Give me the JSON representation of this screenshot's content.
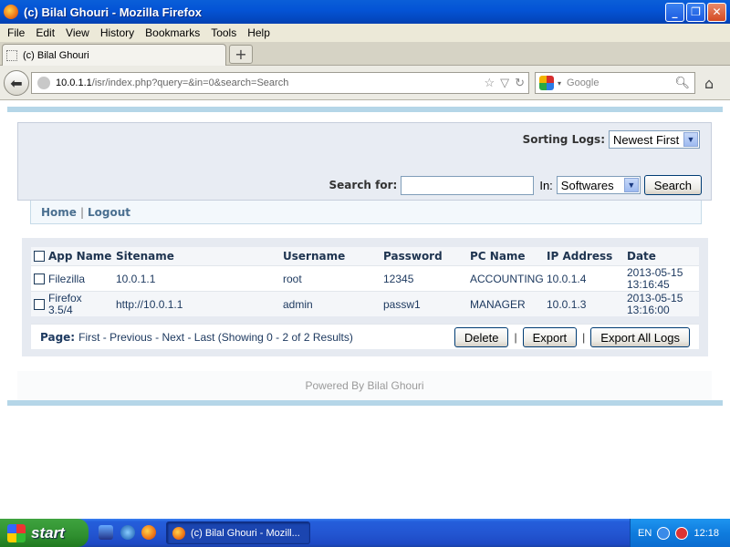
{
  "window": {
    "title": "(c) Bilal Ghouri - Mozilla Firefox"
  },
  "menu": {
    "items": [
      "File",
      "Edit",
      "View",
      "History",
      "Bookmarks",
      "Tools",
      "Help"
    ]
  },
  "tab": {
    "label": "(c) Bilal Ghouri",
    "new_tab_symbol": "+"
  },
  "address": {
    "host": "10.0.1.1",
    "path": "/isr/index.php?query=&in=0&search=Search"
  },
  "search_engine": {
    "placeholder": "Google"
  },
  "page": {
    "sorting_label": "Sorting Logs:",
    "sorting_value": "Newest First",
    "search_label": "Search for:",
    "search_value": "",
    "in_label": "In:",
    "in_value": "Softwares",
    "search_button": "Search",
    "nav": {
      "home": "Home",
      "separator": "|",
      "logout": "Logout"
    },
    "table": {
      "headers": [
        "App Name",
        "Sitename",
        "Username",
        "Password",
        "PC Name",
        "IP Address",
        "Date"
      ],
      "rows": [
        {
          "app": "Filezilla",
          "site": "10.0.1.1",
          "user": "root",
          "pass": "12345",
          "pc": "ACCOUNTING",
          "ip": "10.0.1.4",
          "date1": "2013-05-15",
          "date2": "13:16:45"
        },
        {
          "app1": "Firefox",
          "app2": "3.5/4",
          "site": "http://10.0.1.1",
          "user": "admin",
          "pass": "passw1",
          "pc": "MANAGER",
          "ip": "10.0.1.3",
          "date1": "2013-05-15",
          "date2": "13:16:00"
        }
      ]
    },
    "pager": {
      "label": "Page:",
      "text": "First - Previous - Next - Last (Showing 0 - 2 of 2 Results)",
      "delete": "Delete",
      "export": "Export",
      "export_all": "Export All Logs",
      "separator": "|"
    },
    "footer": "Powered By Bilal Ghouri"
  },
  "taskbar": {
    "start": "start",
    "task_label": "(c) Bilal Ghouri - Mozill...",
    "lang": "EN",
    "clock": "12:18"
  }
}
